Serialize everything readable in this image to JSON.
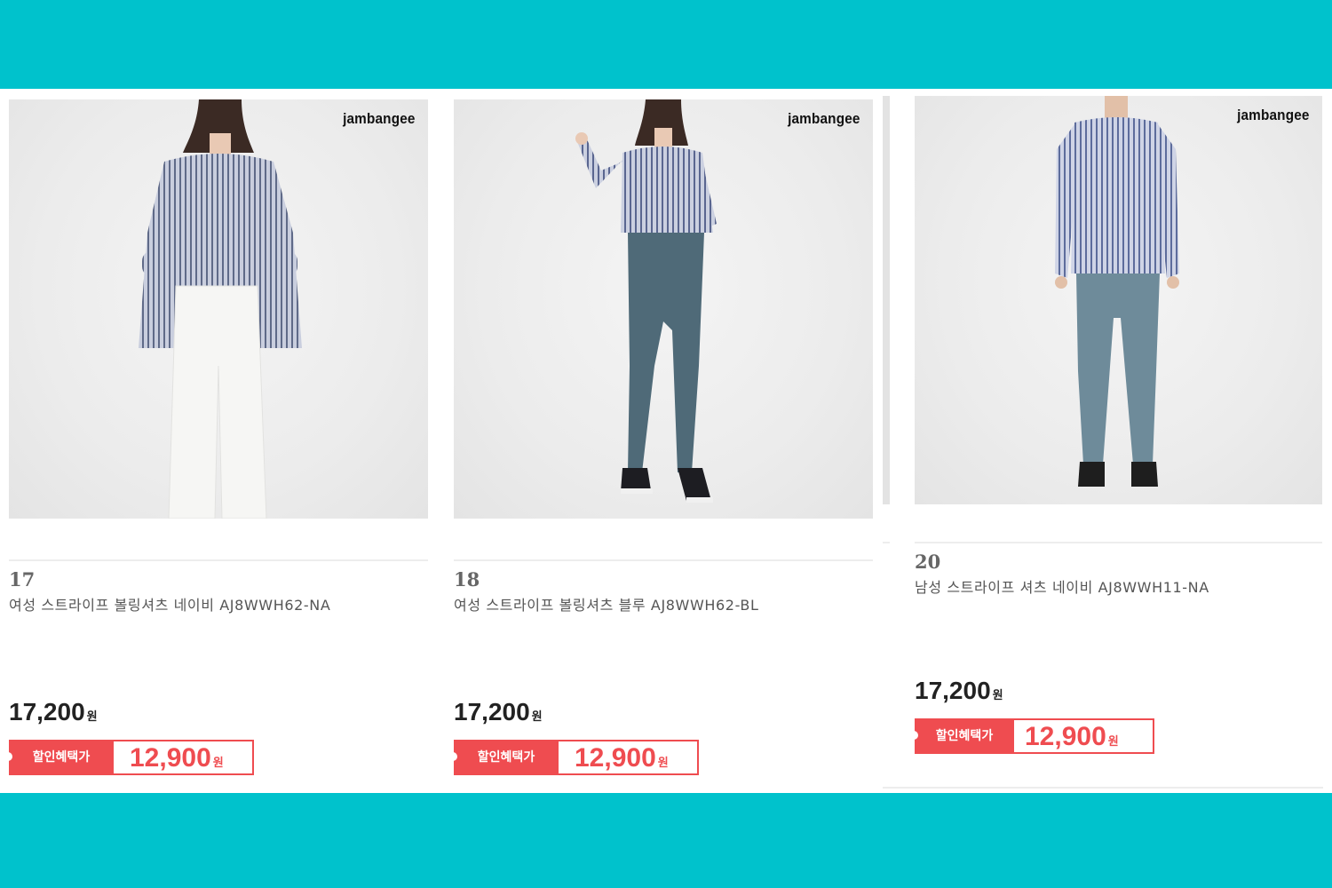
{
  "products": [
    {
      "number": "17",
      "brand": "jambangee",
      "name": "여성 스트라이프 볼링셔츠 네이비 AJ8WWH62-NA",
      "price": "17,200",
      "currency": "원",
      "deal_label": "할인혜택가",
      "sale_price": "12,900",
      "pants_color": "#f6f6f4",
      "shoe_color": "#f6f6f4"
    },
    {
      "number": "18",
      "brand": "jambangee",
      "name": "여성 스트라이프 볼링셔츠 블루 AJ8WWH62-BL",
      "price": "17,200",
      "currency": "원",
      "deal_label": "할인혜택가",
      "sale_price": "12,900",
      "pants_color": "#4f6a78",
      "shoe_color": "#1d1d22"
    },
    {
      "number": "20",
      "brand": "jambangee",
      "name": "남성 스트라이프 셔츠 네이비 AJ8WWH11-NA",
      "price": "17,200",
      "currency": "원",
      "deal_label": "할인혜택가",
      "sale_price": "12,900",
      "pants_color": "#6e8b9a",
      "shoe_color": "#1e1e1e"
    }
  ],
  "colors": {
    "frame": "#00c2cc",
    "accent": "#ef4c50",
    "shirt": "#8f97ad"
  }
}
